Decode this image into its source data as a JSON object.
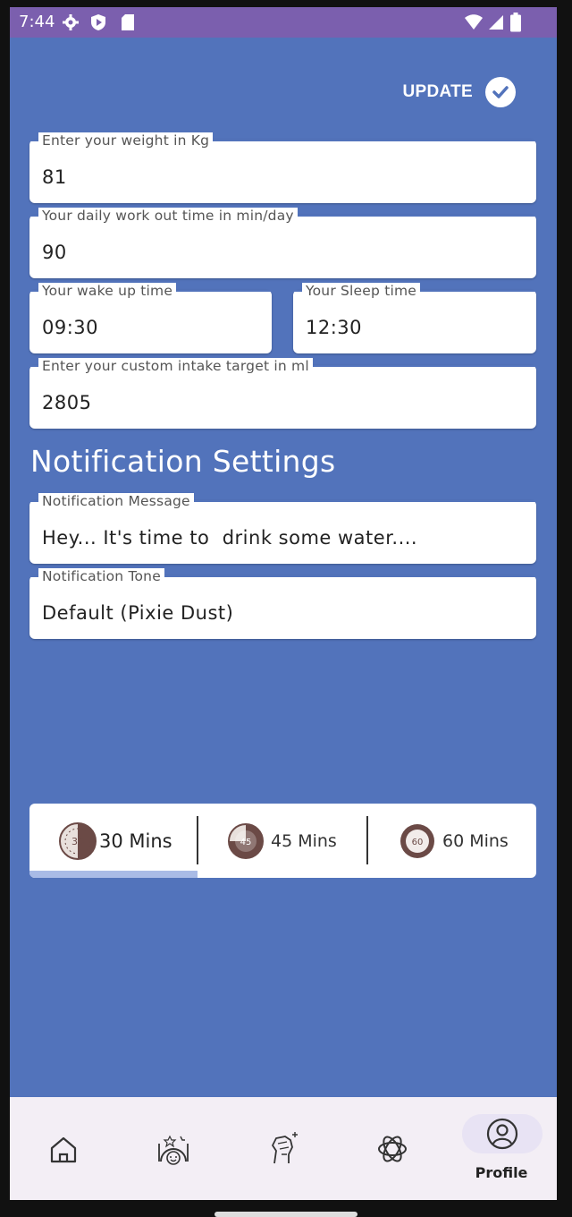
{
  "status_bar": {
    "time": "7:44",
    "left_icons": [
      "gear-icon",
      "shield-play-icon",
      "sd-card-icon"
    ],
    "right_icons": [
      "wifi-icon",
      "signal-icon",
      "battery-icon"
    ]
  },
  "header": {
    "update_label": "UPDATE"
  },
  "profile": {
    "weight": {
      "label": "Enter your weight in Kg",
      "value": "81"
    },
    "workout": {
      "label": "Your daily work out time in min/day",
      "value": "90"
    },
    "wake": {
      "label": "Your wake up time",
      "value": "09:30"
    },
    "sleep": {
      "label": "Your Sleep time",
      "value": "12:30"
    },
    "intake": {
      "label": "Enter your custom intake target in ml",
      "value": "2805"
    }
  },
  "notifications": {
    "title": "Notification Settings",
    "message": {
      "label": "Notification Message",
      "value": "Hey... It's time to  drink some water...."
    },
    "tone": {
      "label": "Notification Tone",
      "value": "Default (Pixie Dust)"
    }
  },
  "interval_tabs": [
    {
      "label": "30 Mins",
      "dial": "30",
      "selected": true
    },
    {
      "label": "45 Mins",
      "dial": "45",
      "selected": false
    },
    {
      "label": "60 Mins",
      "dial": "60",
      "selected": false
    }
  ],
  "bottom_nav": {
    "items": [
      "home-icon",
      "meal-icon",
      "fitness-icon",
      "ai-icon",
      "profile-icon"
    ],
    "active_label": "Profile"
  },
  "colors": {
    "background": "#5273BB",
    "status_bar": "#7B5FAE",
    "nav_bar": "#F3EEF5",
    "tab_indicator": "#A9BBE6",
    "timer_icon": "#6B4A46"
  }
}
